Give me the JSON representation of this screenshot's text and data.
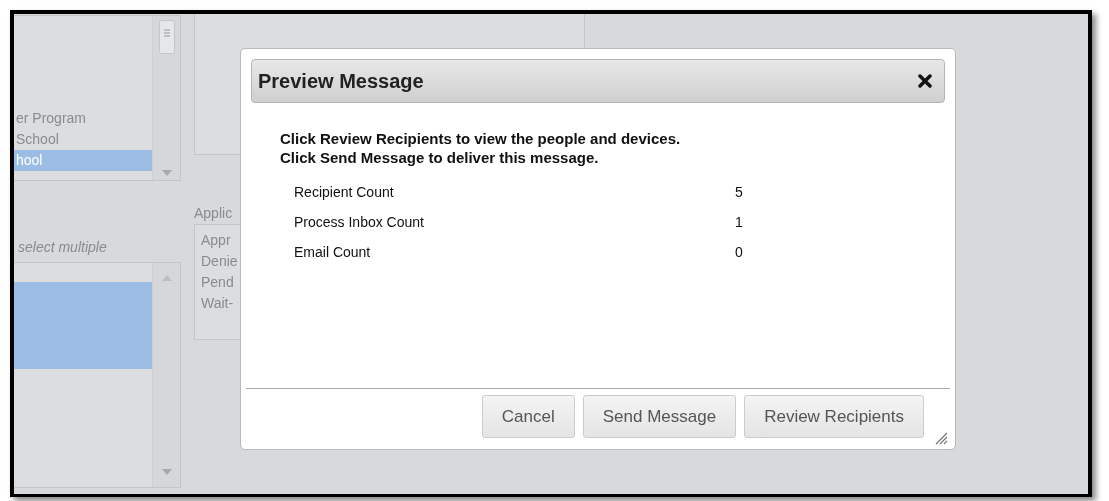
{
  "background": {
    "list_1": {
      "items": [
        {
          "label": "er Program",
          "selected": false
        },
        {
          "label": "School",
          "selected": false
        },
        {
          "label": "hool",
          "selected": true
        }
      ]
    },
    "hint": "select multiple",
    "list_2": {
      "items": [
        {
          "selected": true
        }
      ]
    },
    "status_label": "Applic",
    "status_list": {
      "items": [
        {
          "label": "Appr",
          "selected": false
        },
        {
          "label": "Denie",
          "selected": false
        },
        {
          "label": "Pend",
          "selected": false
        },
        {
          "label": "Wait-",
          "selected": false
        }
      ]
    }
  },
  "dialog": {
    "title": "Preview Message",
    "message": [
      "Click Review Recipients to view the people and devices.",
      "Click Send Message to deliver this message."
    ],
    "counts": [
      {
        "label": "Recipient Count",
        "value": "5"
      },
      {
        "label": "Process Inbox Count",
        "value": "1"
      },
      {
        "label": "Email Count",
        "value": "0"
      }
    ],
    "buttons": [
      "Cancel",
      "Send Message",
      "Review Recipients"
    ]
  }
}
